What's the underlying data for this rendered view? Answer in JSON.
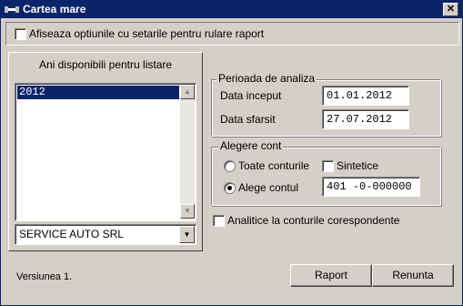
{
  "window": {
    "title": "Cartea mare",
    "close_glyph": "✕"
  },
  "top_option": {
    "label": "Afiseaza optiunile cu setarile pentru rulare raport",
    "checked": false
  },
  "years_panel": {
    "tab_label": "Ani disponibili pentru listare",
    "years": [
      "2012"
    ],
    "selected_year": "2012",
    "company": "SERVICE AUTO SRL"
  },
  "period": {
    "legend": "Perioada de analiza",
    "start_label": "Data inceput",
    "start_value": "01.01.2012",
    "end_label": "Data sfarsit",
    "end_value": "27.07.2012"
  },
  "account": {
    "legend": "Alegere cont",
    "all_label": "Toate conturile",
    "synthetic_label": "Sintetice",
    "choose_label": "Alege contul",
    "account_value": "401  -0-000000",
    "selected": "choose"
  },
  "analytic_option": {
    "label": "Analitice la conturile corespondente",
    "checked": false
  },
  "version_text": "Versiunea 1.",
  "buttons": {
    "report": "Raport",
    "cancel": "Renunta"
  }
}
